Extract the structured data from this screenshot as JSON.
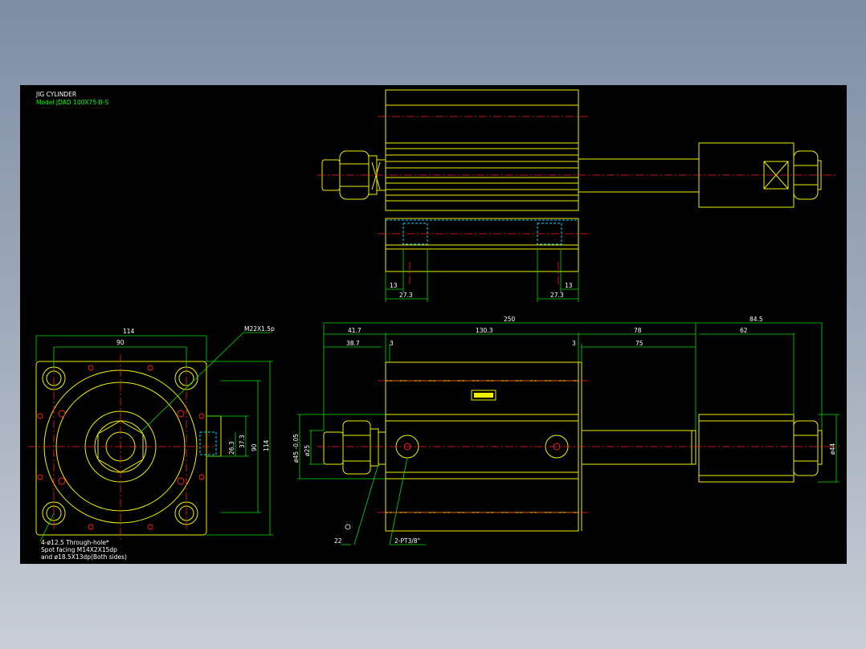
{
  "title_block": {
    "line1": "JIG CYLINDER",
    "line2": "Model  JDAD 100X75-B-S"
  },
  "callouts": {
    "thread": "M22X1.5p",
    "holes_1": "4-ø12.5 Through-hole*",
    "holes_2": "Spot facing  M14X2X15dp",
    "holes_3": "and ø18.5X13dp(Both sides)",
    "port": "2-PT3/8\"",
    "small": "22"
  },
  "dims_top": {
    "left_13": "13",
    "left_27": "27.3",
    "right_13": "13",
    "right_27": "27.3"
  },
  "dims_left": {
    "d114": "114",
    "d90": "90",
    "d26": "26.3",
    "d37": "37.3",
    "dv90": "90",
    "dv114": "114"
  },
  "dims_side": {
    "d250": "250",
    "d84": "84.5",
    "d41": "41.7",
    "d130": "130.3",
    "d78": "78",
    "d62": "62",
    "d38": "38.7",
    "d3a": "3",
    "d3b": "3",
    "d75": "75",
    "dia_rod": "ø25",
    "dia_bore": "ø45 -0.05",
    "dia_44": "ø44"
  },
  "colors": {
    "background": "#000000",
    "outline": "#f0f000",
    "dimension": "#00e000",
    "centerline": "#ff2020",
    "hidden": "#00d8ff",
    "text": "#ffffff"
  }
}
